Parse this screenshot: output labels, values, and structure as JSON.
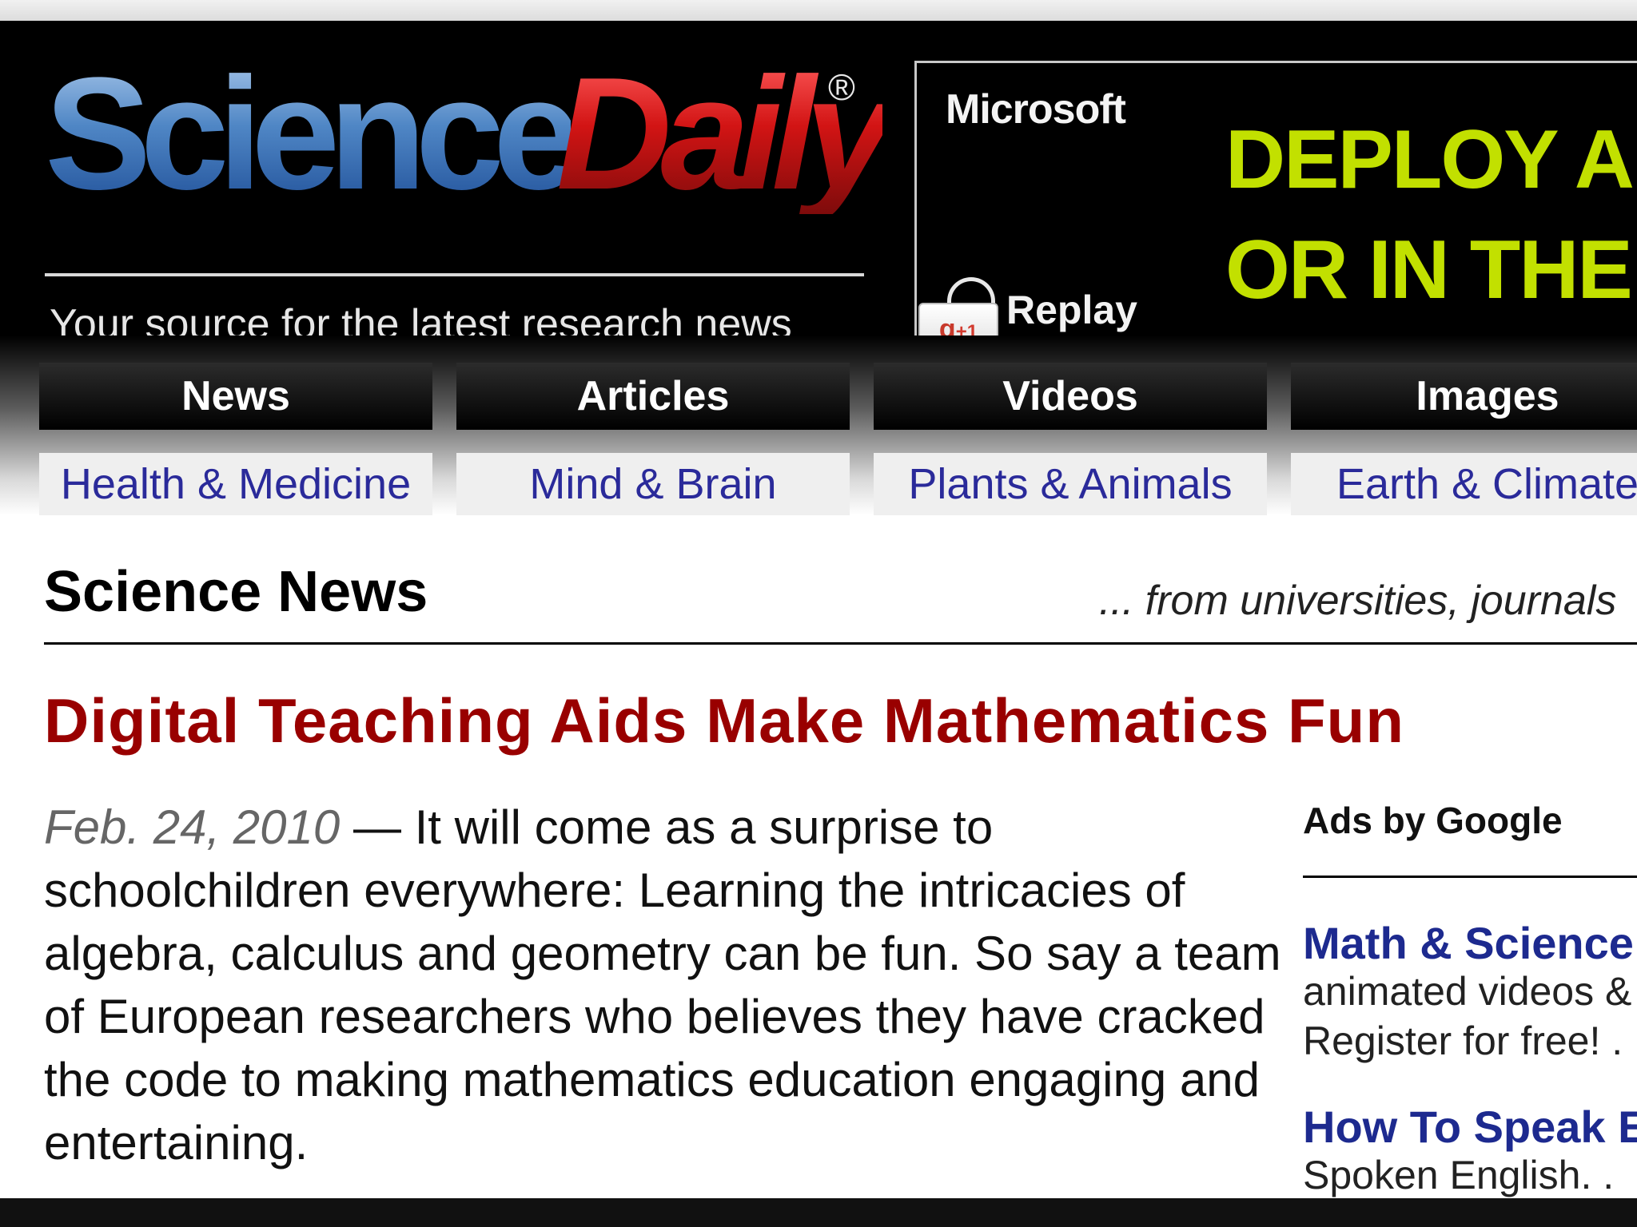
{
  "header": {
    "logo": {
      "word1": "Science",
      "word2": "Daily",
      "registered": "®",
      "tagline": "Your source for the latest research news"
    },
    "ad_banner": {
      "brand": "Microsoft",
      "line1": "DEPLOY APP",
      "line2": "OR IN THE C",
      "replay_label": "Replay",
      "gplus_label": "g",
      "gplus_count": "+1",
      "accent_color": "#c2e000"
    }
  },
  "nav": {
    "tabs": [
      "News",
      "Articles",
      "Videos",
      "Images"
    ],
    "subtabs": [
      "Health & Medicine",
      "Mind & Brain",
      "Plants & Animals",
      "Earth & Climate"
    ]
  },
  "content": {
    "section_title": "Science News",
    "section_sources": "... from universities, journals",
    "headline": "Digital Teaching Aids Make Mathematics Fun",
    "date": "Feb. 24, 2010",
    "dash": " — ",
    "summary": "It will come as a surprise to schoolchildren everywhere: Learning the intricacies of algebra, calculus and geometry can be fun. So say a team of European researchers who believes they have cracked the code to making mathematics education engaging and entertaining."
  },
  "sidebar_ads": {
    "label": "Ads by Google",
    "items": [
      {
        "title": "Math & Science",
        "lines": [
          "animated videos &",
          "Register for free! ."
        ]
      },
      {
        "title": "How To Speak E",
        "lines": [
          "Spoken English. ."
        ]
      }
    ]
  },
  "colors": {
    "headline": "#990000",
    "link": "#1d2a8f",
    "logo_blue": "#4f86c5",
    "logo_red": "#d21414"
  }
}
